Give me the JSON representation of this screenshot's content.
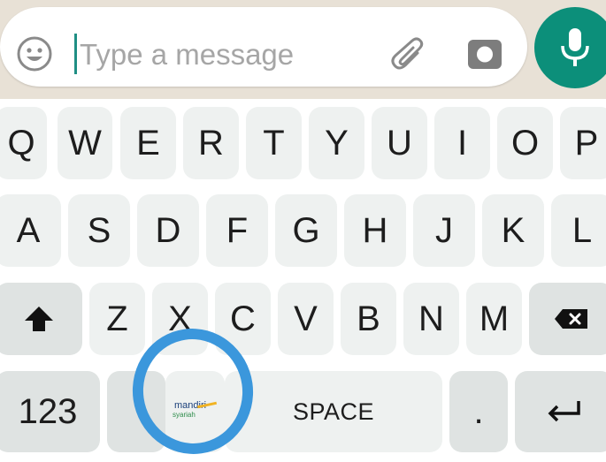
{
  "composer": {
    "placeholder": "Type a message",
    "icons": {
      "emoji": "emoji-icon",
      "attach": "paperclip-icon",
      "camera": "camera-icon",
      "mic": "microphone-icon"
    }
  },
  "keyboard": {
    "row1": [
      "Q",
      "W",
      "E",
      "R",
      "T",
      "Y",
      "U",
      "I",
      "O",
      "P"
    ],
    "row2": [
      "A",
      "S",
      "D",
      "F",
      "G",
      "H",
      "J",
      "K",
      "L"
    ],
    "row3": [
      "Z",
      "X",
      "C",
      "V",
      "B",
      "N",
      "M"
    ],
    "numbers_label": "123",
    "space_label": "SPACE",
    "period_label": ".",
    "icons": {
      "shift": "shift-icon",
      "backspace": "backspace-icon",
      "enter": "enter-icon"
    }
  },
  "suggestion_logo": {
    "name": "mandiri",
    "subtitle": "syariah"
  },
  "colors": {
    "accent": "#0c8f7a",
    "annotation_circle": "#3b97dc",
    "key_bg": "#eef1f0",
    "chat_bg": "#e8e1d6"
  }
}
